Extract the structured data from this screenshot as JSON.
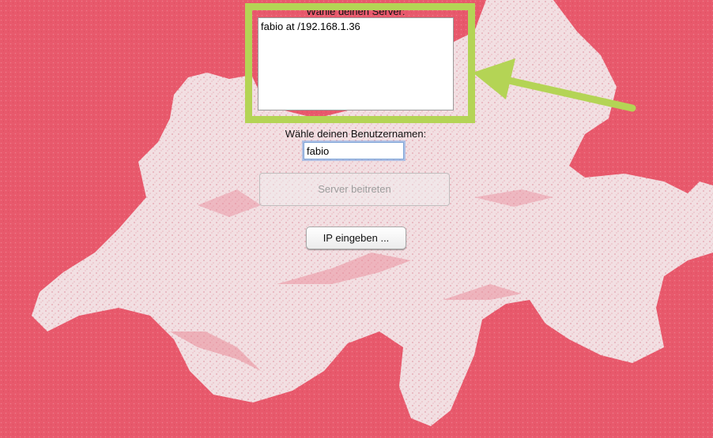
{
  "server_section": {
    "label": "Wähle deinen Server:",
    "servers": [
      {
        "text": "fabio at /192.168.1.36"
      }
    ]
  },
  "user_section": {
    "label": "Wähle deinen Benutzernamen:",
    "username_value": "fabio"
  },
  "buttons": {
    "join_label": "Server beitreten",
    "ip_label": "IP eingeben ..."
  },
  "colors": {
    "background": "#e8596c",
    "map_fill": "#f3e4e6",
    "annotation": "#b4d455"
  }
}
